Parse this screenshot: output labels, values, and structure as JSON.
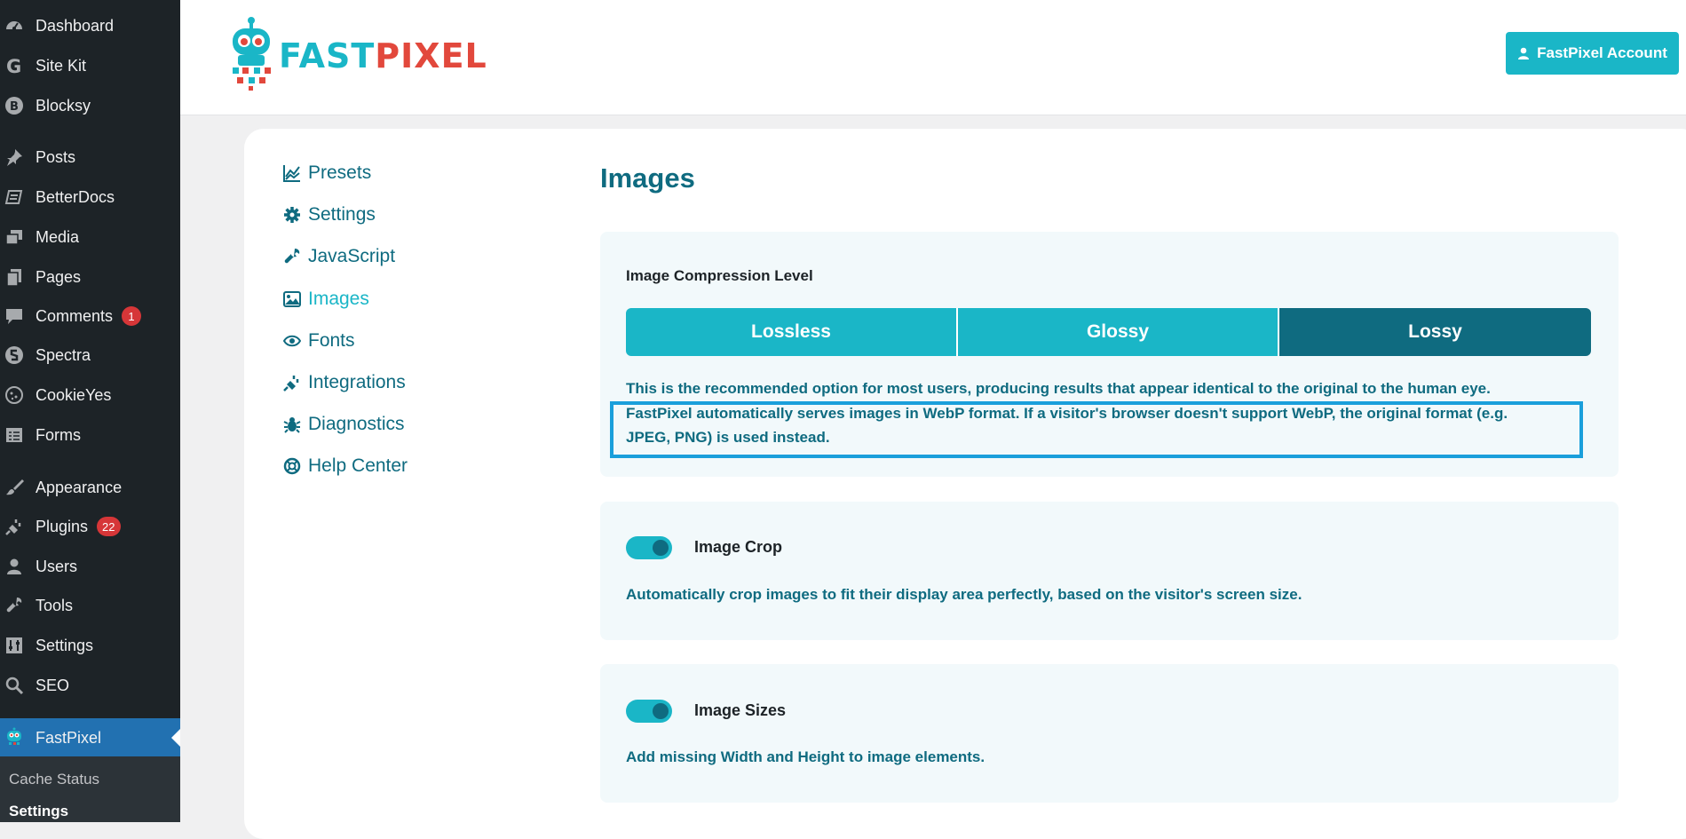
{
  "sidebar": {
    "items": [
      {
        "label": "Dashboard",
        "icon": "dashboard-icon"
      },
      {
        "label": "Site Kit",
        "icon": "google-g-icon"
      },
      {
        "label": "Blocksy",
        "icon": "blocksy-icon"
      },
      {
        "label": "Posts",
        "icon": "pushpin-icon"
      },
      {
        "label": "BetterDocs",
        "icon": "docs-icon"
      },
      {
        "label": "Media",
        "icon": "media-icon"
      },
      {
        "label": "Pages",
        "icon": "pages-icon"
      },
      {
        "label": "Comments",
        "icon": "comment-bubble-icon",
        "badge": "1"
      },
      {
        "label": "Spectra",
        "icon": "spectra-icon"
      },
      {
        "label": "CookieYes",
        "icon": "cookie-icon"
      },
      {
        "label": "Forms",
        "icon": "forms-icon"
      },
      {
        "label": "Appearance",
        "icon": "paintbrush-icon"
      },
      {
        "label": "Plugins",
        "icon": "plug-icon",
        "badge": "22"
      },
      {
        "label": "Users",
        "icon": "user-icon"
      },
      {
        "label": "Tools",
        "icon": "wrench-icon"
      },
      {
        "label": "Settings",
        "icon": "settings-sliders-icon"
      },
      {
        "label": "SEO",
        "icon": "search-icon"
      },
      {
        "label": "FastPixel",
        "icon": "fastpixel-robot-icon"
      }
    ],
    "submenu": [
      {
        "label": "Cache Status"
      },
      {
        "label": "Settings"
      }
    ]
  },
  "header": {
    "logo_part1": "FAST",
    "logo_part2": "PIXEL",
    "account_button": "FastPixel Account"
  },
  "nav": {
    "items": [
      {
        "label": "Presets",
        "icon": "presets-chart-icon"
      },
      {
        "label": "Settings",
        "icon": "gear-icon"
      },
      {
        "label": "JavaScript",
        "icon": "wrench-icon"
      },
      {
        "label": "Images",
        "icon": "image-icon"
      },
      {
        "label": "Fonts",
        "icon": "eye-icon"
      },
      {
        "label": "Integrations",
        "icon": "plug-icon"
      },
      {
        "label": "Diagnostics",
        "icon": "bug-icon"
      },
      {
        "label": "Help Center",
        "icon": "lifebuoy-icon"
      }
    ],
    "current": "Images"
  },
  "main": {
    "title": "Images",
    "compression": {
      "label": "Image Compression Level",
      "options": [
        "Lossless",
        "Glossy",
        "Lossy"
      ],
      "selected": "Lossy",
      "desc_line1": "This is the recommended option for most users, producing results that appear identical to the original to the human eye.",
      "desc_line2": "FastPixel automatically serves images in WebP format. If a visitor's browser doesn't support WebP, the original format (e.g.",
      "desc_line3": "JPEG, PNG) is used instead."
    },
    "crop": {
      "label": "Image Crop",
      "enabled": true,
      "desc": "Automatically crop images to fit their display area perfectly, based on the visitor's screen size."
    },
    "sizes": {
      "label": "Image Sizes",
      "enabled": true,
      "desc": "Add missing Width and Height to image elements."
    }
  },
  "colors": {
    "accent": "#1ab6c7",
    "dark_teal": "#0f6b80",
    "wp_sidebar": "#1d2327",
    "wp_active": "#2271b1",
    "badge": "#d63638",
    "highlight": "#1a9fdb",
    "logo_red": "#e2483c"
  }
}
